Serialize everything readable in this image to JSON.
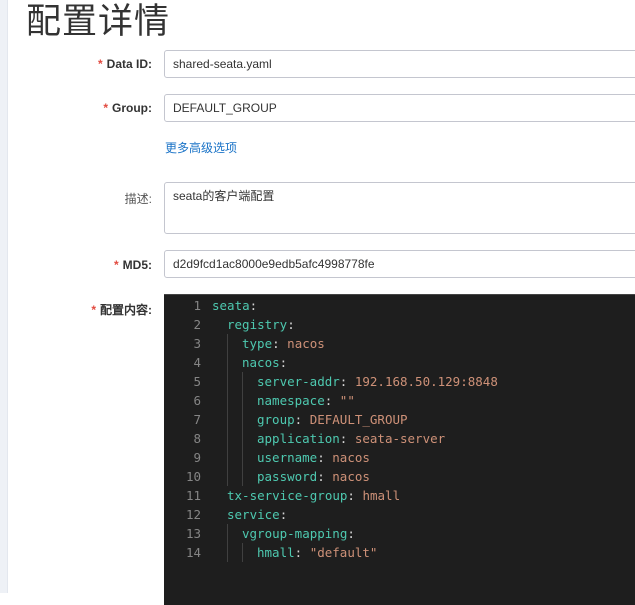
{
  "page": {
    "title": "配置详情"
  },
  "form": {
    "data_id": {
      "label": "Data ID:",
      "value": "shared-seata.yaml"
    },
    "group": {
      "label": "Group:",
      "value": "DEFAULT_GROUP"
    },
    "advanced_link": "更多高级选项",
    "description": {
      "label": "描述:",
      "value": "seata的客户端配置"
    },
    "md5": {
      "label": "MD5:",
      "value": "d2d9fcd1ac8000e9edb5afc4998778fe"
    },
    "content": {
      "label": "配置内容:"
    },
    "required_mark": "*"
  },
  "editor": {
    "lines": [
      {
        "n": "1",
        "key": "seata",
        "val": ""
      },
      {
        "n": "2",
        "key": "registry",
        "val": ""
      },
      {
        "n": "3",
        "key": "type",
        "val": "nacos"
      },
      {
        "n": "4",
        "key": "nacos",
        "val": ""
      },
      {
        "n": "5",
        "key": "server-addr",
        "val": "192.168.50.129:8848"
      },
      {
        "n": "6",
        "key": "namespace",
        "val": "\"\""
      },
      {
        "n": "7",
        "key": "group",
        "val": "DEFAULT_GROUP"
      },
      {
        "n": "8",
        "key": "application",
        "val": "seata-server"
      },
      {
        "n": "9",
        "key": "username",
        "val": "nacos"
      },
      {
        "n": "10",
        "key": "password",
        "val": "nacos"
      },
      {
        "n": "11",
        "key": "tx-service-group",
        "val": "hmall"
      },
      {
        "n": "12",
        "key": "service",
        "val": ""
      },
      {
        "n": "13",
        "key": "vgroup-mapping",
        "val": ""
      },
      {
        "n": "14",
        "key": "hmall",
        "val": "\"default\""
      }
    ],
    "colors": {
      "background": "#1e1e1e",
      "key": "#4ec9b0",
      "value": "#ce9178",
      "gutter": "#858585"
    }
  }
}
